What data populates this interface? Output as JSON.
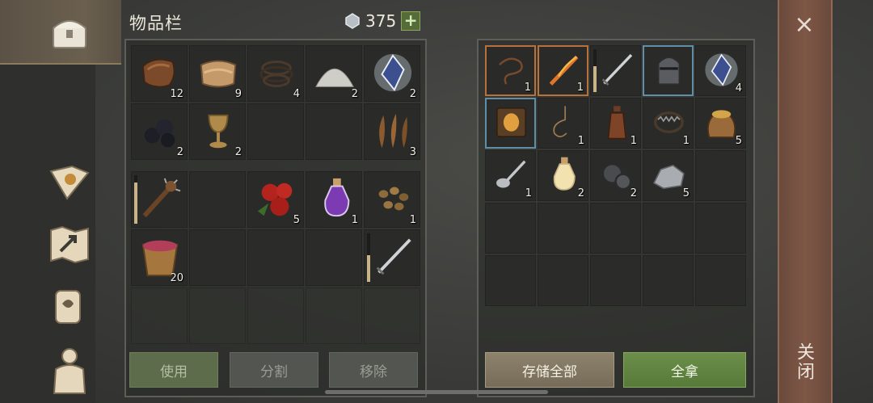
{
  "inventory": {
    "title": "物品栏",
    "currency_value": "375",
    "currency_add": "+",
    "slots_row1": [
      {
        "name": "leather",
        "count": "12"
      },
      {
        "name": "cloth",
        "count": "9"
      },
      {
        "name": "rope",
        "count": "4"
      },
      {
        "name": "salt-pile",
        "count": "2"
      },
      {
        "name": "crystal",
        "count": "2"
      }
    ],
    "slots_row2": [
      {
        "name": "coal",
        "count": "2"
      },
      {
        "name": "goblet",
        "count": "2"
      },
      {
        "name": "",
        "count": ""
      },
      {
        "name": "",
        "count": ""
      },
      {
        "name": "feathers",
        "count": "3"
      }
    ],
    "slots_row3": [
      {
        "name": "spiked-club",
        "count": "",
        "durability": 0.85
      },
      {
        "name": "",
        "count": ""
      },
      {
        "name": "apples",
        "count": "5"
      },
      {
        "name": "potion",
        "count": "1"
      },
      {
        "name": "seeds",
        "count": "1"
      }
    ],
    "slots_row4": [
      {
        "name": "berry-bucket",
        "count": "20"
      },
      {
        "name": "",
        "count": ""
      },
      {
        "name": "",
        "count": ""
      },
      {
        "name": "",
        "count": ""
      },
      {
        "name": "sword",
        "count": "",
        "durability": 0.55
      }
    ],
    "buttons": {
      "use": "使用",
      "split": "分割",
      "remove": "移除"
    }
  },
  "storage": {
    "slots_row1": [
      {
        "name": "whip",
        "count": "1"
      },
      {
        "name": "fire-sword",
        "count": "1"
      },
      {
        "name": "sword",
        "count": "",
        "durability": 0.6
      },
      {
        "name": "helmet",
        "count": ""
      },
      {
        "name": "crystal",
        "count": "4"
      }
    ],
    "slots_row2": [
      {
        "name": "mask-book",
        "count": ""
      },
      {
        "name": "rope-loop",
        "count": "1"
      },
      {
        "name": "flask",
        "count": "1"
      },
      {
        "name": "bear-trap",
        "count": "1"
      },
      {
        "name": "grain-sack",
        "count": "5"
      }
    ],
    "slots_row3": [
      {
        "name": "spoon",
        "count": "1"
      },
      {
        "name": "lantern-potion",
        "count": "2"
      },
      {
        "name": "gears",
        "count": "2"
      },
      {
        "name": "silver-ore",
        "count": "5"
      },
      {
        "name": "",
        "count": ""
      }
    ],
    "buttons": {
      "store_all": "存储全部",
      "take_all": "全拿"
    }
  },
  "close": {
    "icon": "×",
    "label": "关闭"
  }
}
